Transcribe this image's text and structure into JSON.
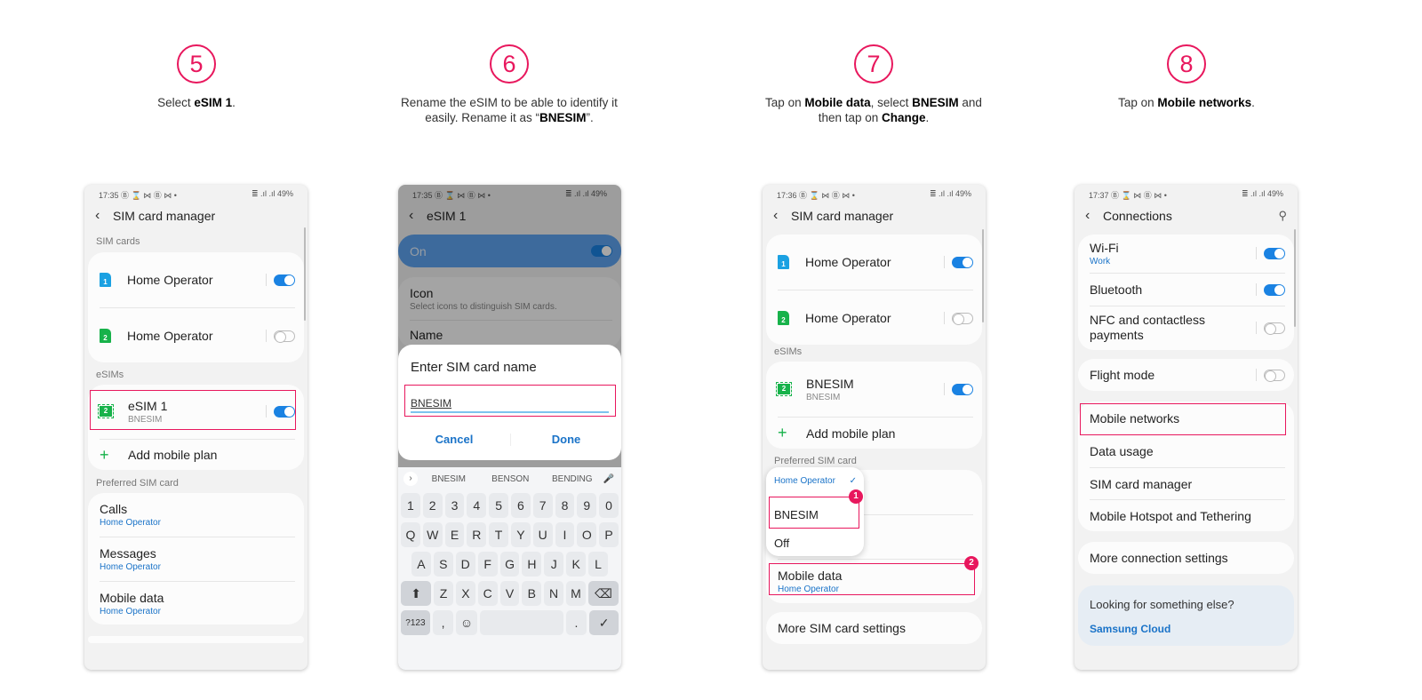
{
  "steps": [
    {
      "number": "5",
      "text_parts": [
        "Select ",
        "eSIM 1",
        "."
      ]
    },
    {
      "number": "6",
      "text_parts": [
        "Rename the eSIM to be able to identify it easily. Rename it as “",
        "BNESIM",
        "”."
      ]
    },
    {
      "number": "7",
      "text_parts": [
        "Tap on ",
        "Mobile data",
        ", select ",
        "BNESIM",
        " and then tap on ",
        "Change",
        "."
      ]
    },
    {
      "number": "8",
      "text_parts": [
        "Tap on ",
        "Mobile networks",
        "."
      ]
    }
  ],
  "accent_color": "#e8175d",
  "phone1": {
    "status_time": "17:35",
    "status_icons": "Ⓑ ⌛ ⋈ Ⓑ ⋈ •",
    "status_right": "≣ .ıl .ıl 49%",
    "title": "SIM card manager",
    "sim_cards_label": "SIM cards",
    "sims": [
      {
        "slot": "1",
        "name": "Home Operator",
        "enabled": true
      },
      {
        "slot": "2",
        "name": "Home Operator",
        "enabled": false
      }
    ],
    "esims_label": "eSIMs",
    "esim": {
      "slot": "2",
      "name": "eSIM 1",
      "carrier": "BNESIM",
      "enabled": true
    },
    "add_plan": "Add mobile plan",
    "preferred_label": "Preferred SIM card",
    "preferred": [
      {
        "title": "Calls",
        "value": "Home Operator"
      },
      {
        "title": "Messages",
        "value": "Home Operator"
      },
      {
        "title": "Mobile data",
        "value": "Home Operator"
      }
    ]
  },
  "phone2": {
    "status_time": "17:35",
    "status_icons": "Ⓑ ⌛ ⋈ Ⓑ ⋈ •",
    "status_right": "≣ .ıl .ıl 49%",
    "title": "eSIM 1",
    "on_label": "On",
    "icon_title": "Icon",
    "icon_sub": "Select icons to distinguish SIM cards.",
    "name_title": "Name",
    "dialog_title": "Enter SIM card name",
    "input_value": "BNESIM",
    "cancel": "Cancel",
    "done": "Done",
    "suggestions": [
      "BNESIM",
      "BENSON",
      "BENDING"
    ],
    "keys_numbers": [
      "1",
      "2",
      "3",
      "4",
      "5",
      "6",
      "7",
      "8",
      "9",
      "0"
    ],
    "keys_row1": [
      "Q",
      "W",
      "E",
      "R",
      "T",
      "Y",
      "U",
      "I",
      "O",
      "P"
    ],
    "keys_row2": [
      "A",
      "S",
      "D",
      "F",
      "G",
      "H",
      "J",
      "K",
      "L"
    ],
    "keys_row3": [
      "Z",
      "X",
      "C",
      "V",
      "B",
      "N",
      "M"
    ],
    "key_symbols": "?123",
    "key_comma": ",",
    "key_period": ".",
    "key_emoji": "☺",
    "key_enter": "✓",
    "key_shift": "⬆",
    "key_backspace": "⌫"
  },
  "phone3": {
    "status_time": "17:36",
    "status_icons": "Ⓑ ⌛ ⋈ Ⓑ ⋈ •",
    "status_right": "≣ .ıl .ıl 49%",
    "title": "SIM card manager",
    "sims": [
      {
        "slot": "1",
        "name": "Home Operator",
        "enabled": true
      },
      {
        "slot": "2",
        "name": "Home Operator",
        "enabled": false
      }
    ],
    "esims_label": "eSIMs",
    "esim": {
      "slot": "2",
      "name": "BNESIM",
      "carrier": "BNESIM",
      "enabled": true
    },
    "add_plan": "Add mobile plan",
    "preferred_label": "Preferred SIM card",
    "dropdown": {
      "selected": "Home Operator",
      "options": [
        "BNESIM",
        "Off"
      ]
    },
    "mobile_data": {
      "title": "Mobile data",
      "value": "Home Operator"
    },
    "more_settings": "More SIM card settings",
    "markers": [
      "1",
      "2"
    ]
  },
  "phone4": {
    "status_time": "17:37",
    "status_icons": "Ⓑ ⌛ ⋈ Ⓑ ⋈ •",
    "status_right": "≣ .ıl .ıl 49%",
    "title": "Connections",
    "wifi": {
      "title": "Wi-Fi",
      "sub": "Work",
      "enabled": true
    },
    "bluetooth": {
      "title": "Bluetooth",
      "enabled": true
    },
    "nfc": {
      "title": "NFC and contactless payments",
      "enabled": false
    },
    "flight": {
      "title": "Flight mode",
      "enabled": false
    },
    "menu": [
      "Mobile networks",
      "Data usage",
      "SIM card manager",
      "Mobile Hotspot and Tethering"
    ],
    "more": "More connection settings",
    "help_title": "Looking for something else?",
    "help_link": "Samsung Cloud"
  }
}
